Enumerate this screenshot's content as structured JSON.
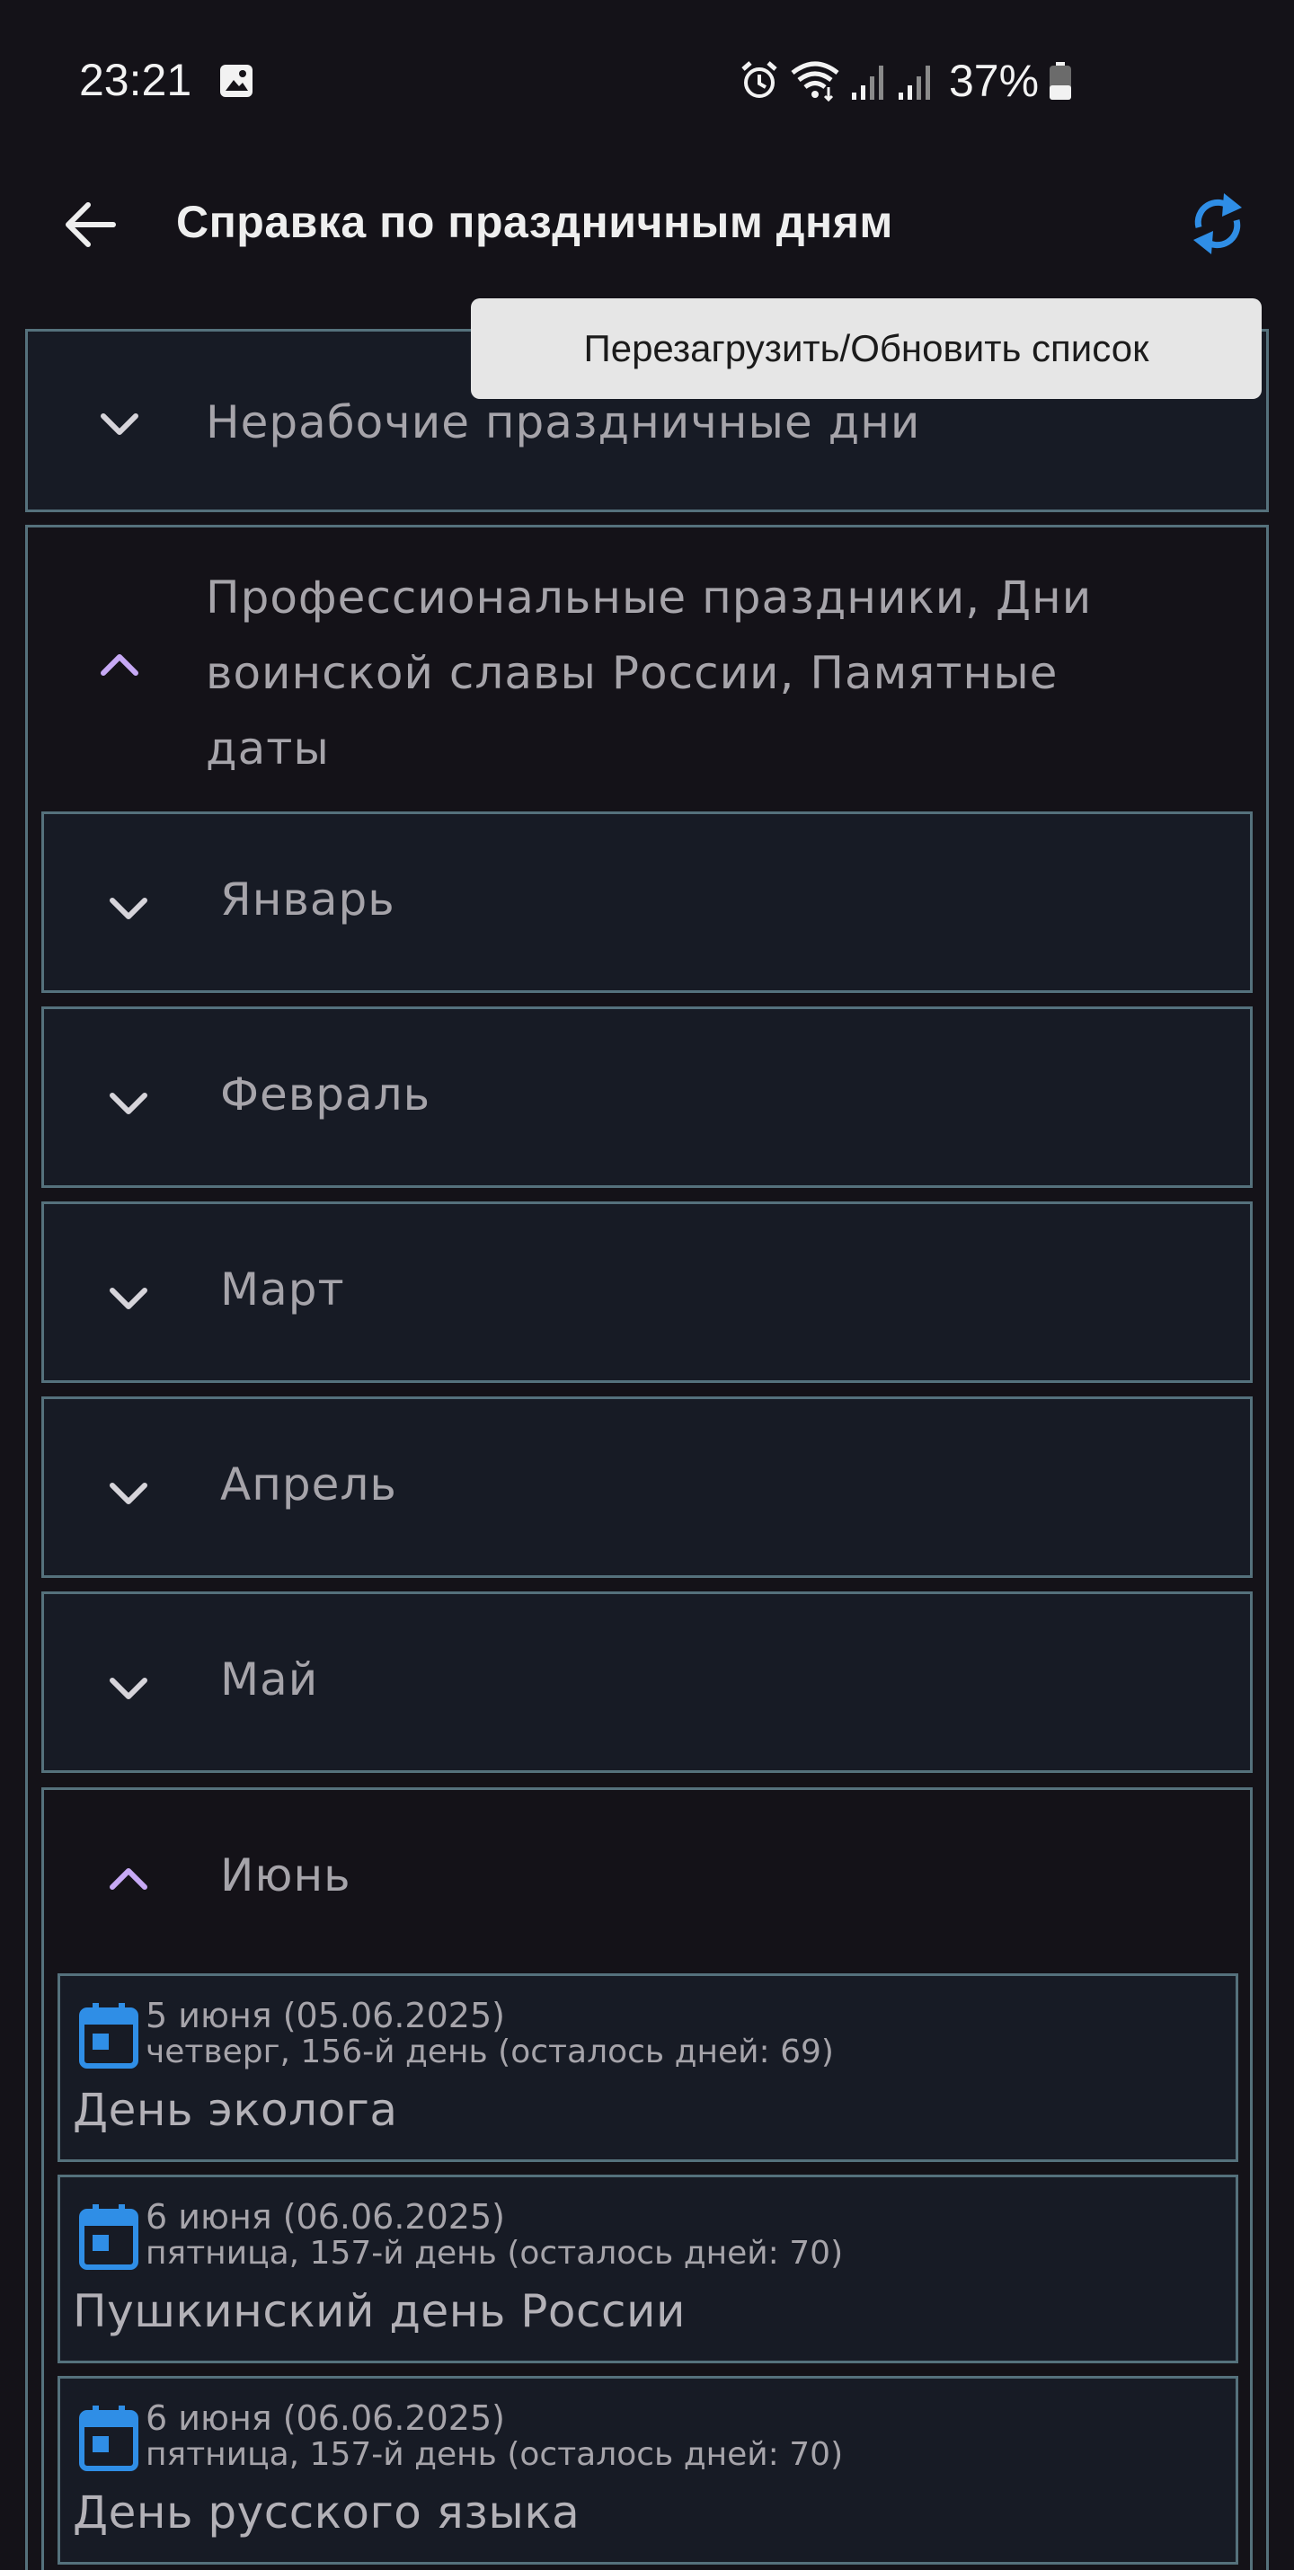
{
  "status_bar": {
    "time": "23:21",
    "battery": "37%",
    "icons": [
      "gallery-icon",
      "alarm-icon",
      "wifi-icon",
      "signal-icon",
      "signal-icon",
      "battery-icon"
    ]
  },
  "app_bar": {
    "title": "Справка по праздничным дням",
    "back_icon": "arrow-back-icon",
    "refresh_icon": "refresh-icon",
    "accent_color": "#2f8ee6"
  },
  "tooltip": {
    "text": "Перезагрузить/Обновить список"
  },
  "sections": [
    {
      "label": "Нерабочие праздничные дни",
      "expanded": false
    },
    {
      "label": "Профессиональные праздники, Дни воинской славы России, Памятные даты",
      "expanded": true
    }
  ],
  "months": [
    {
      "label": "Январь",
      "expanded": false
    },
    {
      "label": "Февраль",
      "expanded": false
    },
    {
      "label": "Март",
      "expanded": false
    },
    {
      "label": "Апрель",
      "expanded": false
    },
    {
      "label": "Май",
      "expanded": false
    },
    {
      "label": "Июнь",
      "expanded": true
    }
  ],
  "events": [
    {
      "date": "5 июня (05.06.2025)",
      "meta": "четверг, 156-й день (осталось дней: 69)",
      "name": "День эколога"
    },
    {
      "date": "6 июня (06.06.2025)",
      "meta": "пятница, 157-й день (осталось дней: 70)",
      "name": "Пушкинский день России"
    },
    {
      "date": "6 июня (06.06.2025)",
      "meta": "пятница, 157-й день (осталось дней: 70)",
      "name": "День русского языка"
    }
  ],
  "colors": {
    "background": "#141218",
    "panel": "#171b25",
    "border": "#55717c",
    "expanded_chevron": "#c7a9f5",
    "collapsed_chevron": "#d6d4da",
    "calendar_icon": "#2f8ee6"
  }
}
